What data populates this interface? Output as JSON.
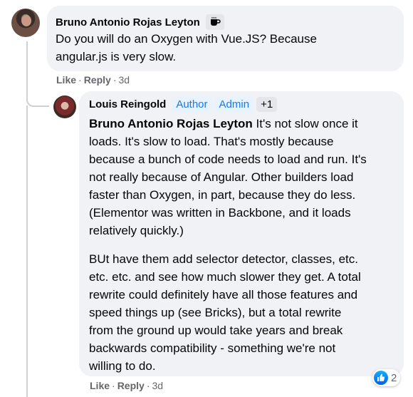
{
  "comment": {
    "author": "Bruno Antonio Rojas Leyton",
    "badge_icon": "coffee-cup-icon",
    "text_line1": "Do you will do an Oxygen with Vue.JS? Because",
    "text_line2": "angular.js is very slow.",
    "like_label": "Like",
    "reply_label": "Reply",
    "time": "3d"
  },
  "reply": {
    "author": "Louis Reingold",
    "badges": [
      "Author",
      "Admin"
    ],
    "badge_more": "+1",
    "mention": "Bruno Antonio Rojas Leyton",
    "p1": [
      " It's not slow once it",
      "loads. It's slow to load. That's mostly because",
      "because a bunch of code needs to load and run. It's",
      "not really because of Angular. Other builders load",
      "faster than Oxygen, in part, because they do less.",
      "(Elementor was written in Backbone, and it loads",
      "relatively quickly.)"
    ],
    "p2": [
      "BUt have them add selector detector, classes, etc.",
      "etc. etc. and see how much slower they get. A total",
      "rewrite could definitely have all those features and",
      "speed things up (see Bricks), but a total rewrite",
      "from the ground up would take years and break",
      "backwards compatibility - something we're not",
      "willing to do."
    ],
    "reaction_count": "2",
    "reaction_icon": "like-thumb-icon",
    "like_label": "Like",
    "reply_label": "Reply",
    "time": "3d"
  },
  "colors": {
    "bubble": "#f0f2f5",
    "badge_bg": "#e7f3ff",
    "badge_text": "#1877f2",
    "meta_text": "#65676b"
  }
}
